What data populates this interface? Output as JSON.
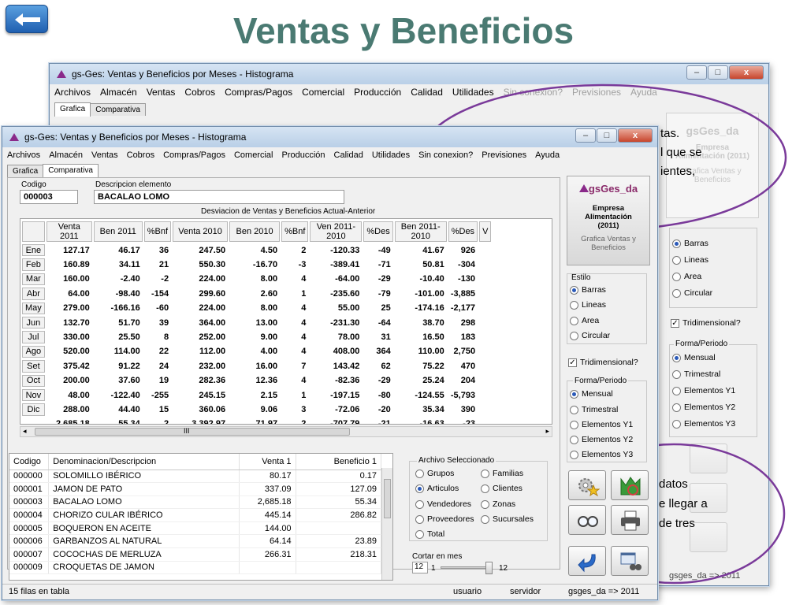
{
  "slide_title": "Ventas y Beneficios",
  "back_window": {
    "title": "gs-Ges: Ventas y Beneficios por Meses - Histograma",
    "menu": [
      "Archivos",
      "Almacén",
      "Ventas",
      "Cobros",
      "Compras/Pagos",
      "Comercial",
      "Producción",
      "Calidad",
      "Utilidades"
    ],
    "menu_dim": [
      "Sin conexion?",
      "Previsiones",
      "Ayuda"
    ],
    "tabs": [
      "Grafica",
      "Comparativa"
    ],
    "logo_text": "gsGes_da",
    "empresa": "Empresa Alimentación (2011)",
    "grafica_label": "Grafica Ventas y Beneficios",
    "estilo": [
      "Barras",
      "Lineas",
      "Area",
      "Circular"
    ],
    "tridimensional": "Tridimensional?",
    "forma_title": "Forma/Periodo",
    "forma": [
      "Mensual",
      "Trimestral",
      "Elementos Y1",
      "Elementos Y2",
      "Elementos Y3"
    ],
    "status_right": "gsges_da => 2011"
  },
  "callout_top": [
    "tas.",
    "l que se",
    "ientes,"
  ],
  "callout_bottom": [
    "datos",
    "e llegar a",
    "de tres"
  ],
  "window": {
    "title": "gs-Ges: Ventas y Beneficios por Meses - Histograma",
    "menu": [
      "Archivos",
      "Almacén",
      "Ventas",
      "Cobros",
      "Compras/Pagos",
      "Comercial",
      "Producción",
      "Calidad",
      "Utilidades",
      "Sin conexion?",
      "Previsiones",
      "Ayuda"
    ],
    "tabs": [
      "Grafica",
      "Comparativa"
    ],
    "codigo_label": "Codigo",
    "codigo_value": "000003",
    "desc_label": "Descripcion elemento",
    "desc_value": "BACALAO LOMO",
    "grid_caption": "Desviacion de Ventas y Beneficios Actual-Anterior",
    "grid_headers": [
      "Venta 2011",
      "Ben 2011",
      "%Bnf",
      "Venta 2010",
      "Ben 2010",
      "%Bnf",
      "Ven 2011-2010",
      "%Des",
      "Ben 2011-2010",
      "%Des",
      "V"
    ],
    "grid_rows": [
      {
        "m": "Ene",
        "v": [
          "127.17",
          "46.17",
          "36",
          "247.50",
          "4.50",
          "2",
          "-120.33",
          "-49",
          "41.67",
          "926"
        ]
      },
      {
        "m": "Feb",
        "v": [
          "160.89",
          "34.11",
          "21",
          "550.30",
          "-16.70",
          "-3",
          "-389.41",
          "-71",
          "50.81",
          "-304"
        ]
      },
      {
        "m": "Mar",
        "v": [
          "160.00",
          "-2.40",
          "-2",
          "224.00",
          "8.00",
          "4",
          "-64.00",
          "-29",
          "-10.40",
          "-130"
        ]
      },
      {
        "m": "Abr",
        "v": [
          "64.00",
          "-98.40",
          "-154",
          "299.60",
          "2.60",
          "1",
          "-235.60",
          "-79",
          "-101.00",
          "-3,885"
        ]
      },
      {
        "m": "May",
        "v": [
          "279.00",
          "-166.16",
          "-60",
          "224.00",
          "8.00",
          "4",
          "55.00",
          "25",
          "-174.16",
          "-2,177"
        ]
      },
      {
        "m": "Jun",
        "v": [
          "132.70",
          "51.70",
          "39",
          "364.00",
          "13.00",
          "4",
          "-231.30",
          "-64",
          "38.70",
          "298"
        ]
      },
      {
        "m": "Jul",
        "v": [
          "330.00",
          "25.50",
          "8",
          "252.00",
          "9.00",
          "4",
          "78.00",
          "31",
          "16.50",
          "183"
        ]
      },
      {
        "m": "Ago",
        "v": [
          "520.00",
          "114.00",
          "22",
          "112.00",
          "4.00",
          "4",
          "408.00",
          "364",
          "110.00",
          "2,750"
        ]
      },
      {
        "m": "Set",
        "v": [
          "375.42",
          "91.22",
          "24",
          "232.00",
          "16.00",
          "7",
          "143.42",
          "62",
          "75.22",
          "470"
        ]
      },
      {
        "m": "Oct",
        "v": [
          "200.00",
          "37.60",
          "19",
          "282.36",
          "12.36",
          "4",
          "-82.36",
          "-29",
          "25.24",
          "204"
        ]
      },
      {
        "m": "Nov",
        "v": [
          "48.00",
          "-122.40",
          "-255",
          "245.15",
          "2.15",
          "1",
          "-197.15",
          "-80",
          "-124.55",
          "-5,793"
        ]
      },
      {
        "m": "Dic",
        "v": [
          "288.00",
          "44.40",
          "15",
          "360.06",
          "9.06",
          "3",
          "-72.06",
          "-20",
          "35.34",
          "390"
        ]
      },
      {
        "m": "",
        "v": [
          "2,685.18",
          "55.34",
          "2",
          "3,392.97",
          "71.97",
          "2",
          "-707.79",
          "-21",
          "-16.63",
          "-23"
        ]
      }
    ],
    "list_headers": [
      "Codigo",
      "Denominacion/Descripcion",
      "Venta 1",
      "Beneficio 1"
    ],
    "list_rows": [
      [
        "000000",
        "SOLOMILLO IBÉRICO",
        "80.17",
        "0.17"
      ],
      [
        "000001",
        "JAMON DE PATO",
        "337.09",
        "127.09"
      ],
      [
        "000003",
        "BACALAO LOMO",
        "2,685.18",
        "55.34"
      ],
      [
        "000004",
        "CHORIZO CULAR IBÉRICO",
        "445.14",
        "286.82"
      ],
      [
        "000005",
        "BOQUERON EN ACEITE",
        "144.00",
        ""
      ],
      [
        "000006",
        "GARBANZOS AL NATURAL",
        "64.14",
        "23.89"
      ],
      [
        "000007",
        "COCOCHAS DE MERLUZA",
        "266.31",
        "218.31"
      ],
      [
        "000009",
        "CROQUETAS DE JAMON",
        "",
        ""
      ]
    ],
    "archivo_title": "Archivo Seleccionado",
    "archivo_left": [
      "Grupos",
      "Articulos",
      "Vendedores",
      "Proveedores",
      "Total"
    ],
    "archivo_right": [
      "Familias",
      "Clientes",
      "Zonas",
      "Sucursales"
    ],
    "cortar_label": "Cortar en mes",
    "cortar_value": "12",
    "slider_min": "1",
    "slider_max": "12",
    "logo_text": "gsGes_da",
    "empresa_lines": [
      "Empresa",
      "Alimentación",
      "(2011)"
    ],
    "grafica_lines": [
      "Grafica Ventas y",
      "Beneficios"
    ],
    "estilo_title": "Estilo",
    "estilo": [
      "Barras",
      "Lineas",
      "Area",
      "Circular"
    ],
    "tridimensional": "Tridimensional?",
    "forma_title": "Forma/Periodo",
    "forma": [
      "Mensual",
      "Trimestral",
      "Elementos Y1",
      "Elementos Y2",
      "Elementos Y3"
    ],
    "status": {
      "left": "15 filas en tabla",
      "user": "usuario",
      "server": "servidor",
      "db": "gsges_da => 2011"
    },
    "scroll_mark": "III",
    "check_mark": "✓"
  }
}
